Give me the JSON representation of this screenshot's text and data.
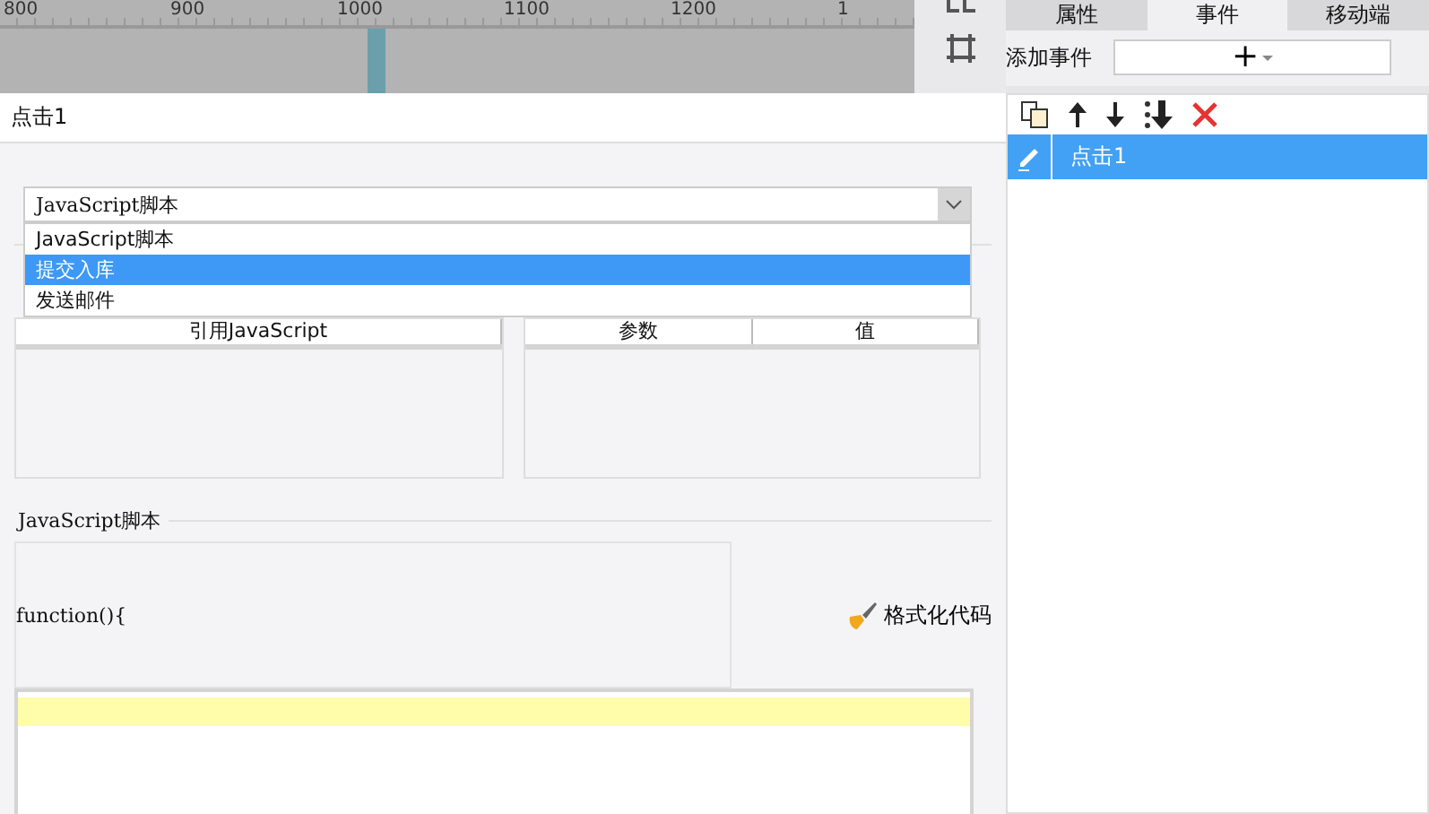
{
  "ruler": {
    "ticks": [
      "800",
      "900",
      "1000",
      "1100",
      "1200",
      "1"
    ]
  },
  "right_tabs": [
    {
      "label": "属性",
      "selected": false
    },
    {
      "label": "事件",
      "selected": true
    },
    {
      "label": "移动端",
      "selected": false
    }
  ],
  "add_event": {
    "label": "添加事件",
    "button": "+"
  },
  "events": [
    {
      "label": "点击1",
      "selected": true
    }
  ],
  "dialog": {
    "title": "点击1",
    "action_select": {
      "value": "JavaScript脚本",
      "expanded": true,
      "options": [
        {
          "label": "JavaScript脚本",
          "highlighted": false
        },
        {
          "label": "提交入库",
          "highlighted": true
        },
        {
          "label": "发送邮件",
          "highlighted": false
        }
      ]
    },
    "ref_table": {
      "columns": [
        "引用JavaScript"
      ]
    },
    "param_table": {
      "columns": [
        "参数",
        "值"
      ]
    },
    "script_section": {
      "legend": "JavaScript脚本",
      "header": "function(){",
      "format_button": "格式化代码"
    }
  }
}
